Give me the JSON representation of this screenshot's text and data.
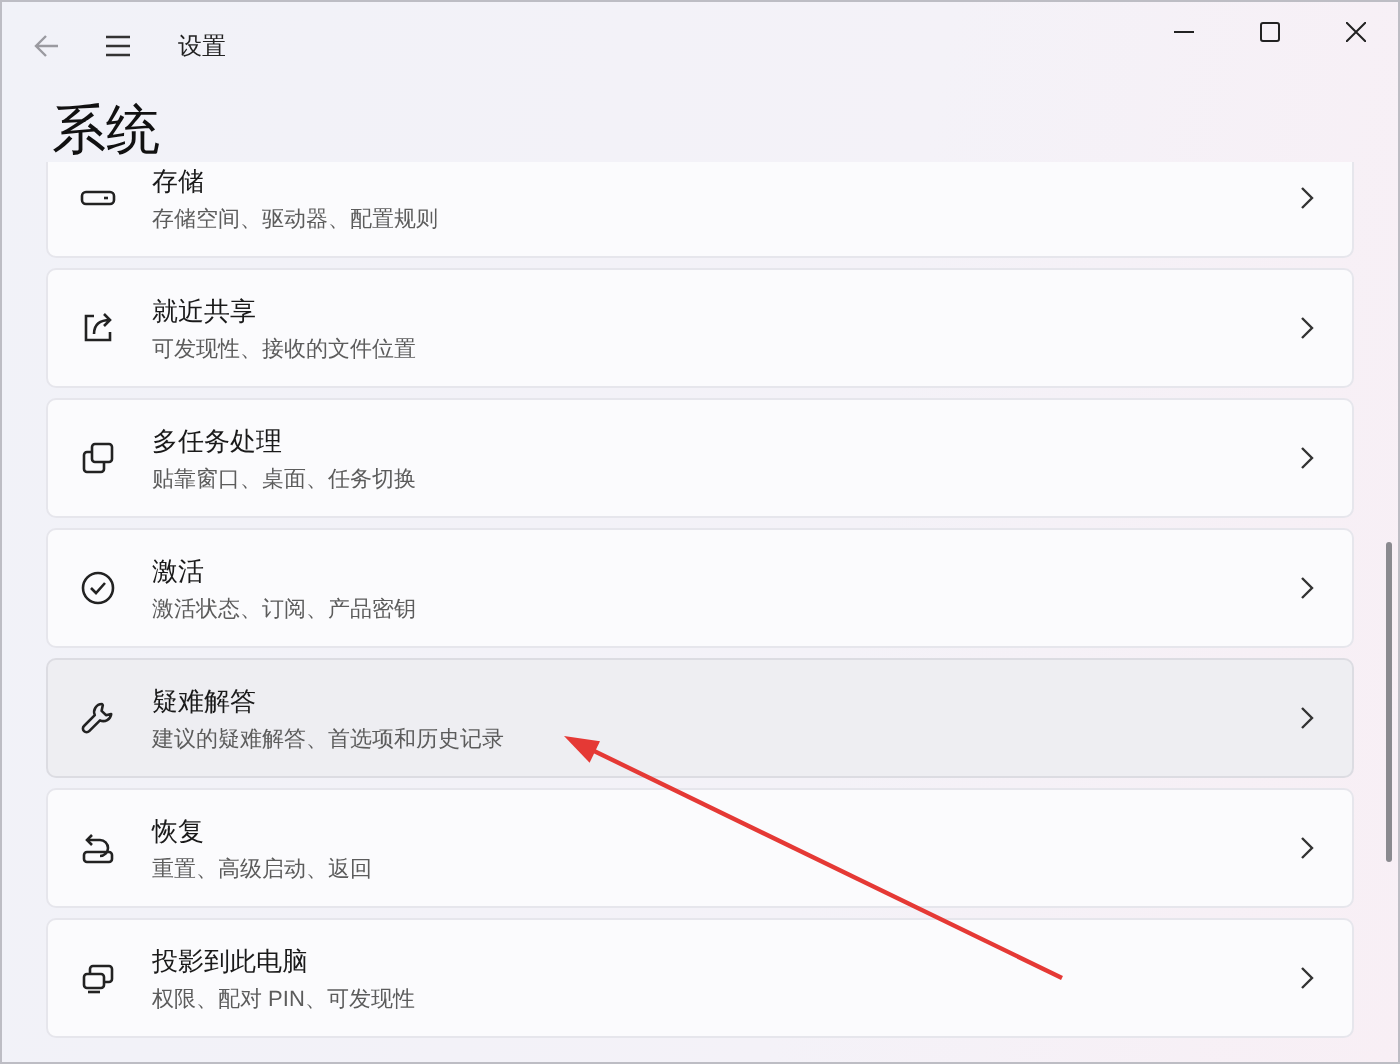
{
  "window": {
    "title": "设置",
    "back_disabled": true
  },
  "page_title": "系统",
  "items": [
    {
      "title": "存储",
      "subtitle": "存储空间、驱动器、配置规则",
      "hovered": false
    },
    {
      "title": "就近共享",
      "subtitle": "可发现性、接收的文件位置",
      "hovered": false
    },
    {
      "title": "多任务处理",
      "subtitle": "贴靠窗口、桌面、任务切换",
      "hovered": false
    },
    {
      "title": "激活",
      "subtitle": "激活状态、订阅、产品密钥",
      "hovered": false
    },
    {
      "title": "疑难解答",
      "subtitle": "建议的疑难解答、首选项和历史记录",
      "hovered": true
    },
    {
      "title": "恢复",
      "subtitle": "重置、高级启动、返回",
      "hovered": false
    },
    {
      "title": "投影到此电脑",
      "subtitle": "权限、配对 PIN、可发现性",
      "hovered": false
    }
  ],
  "annotation": {
    "kind": "arrow"
  }
}
